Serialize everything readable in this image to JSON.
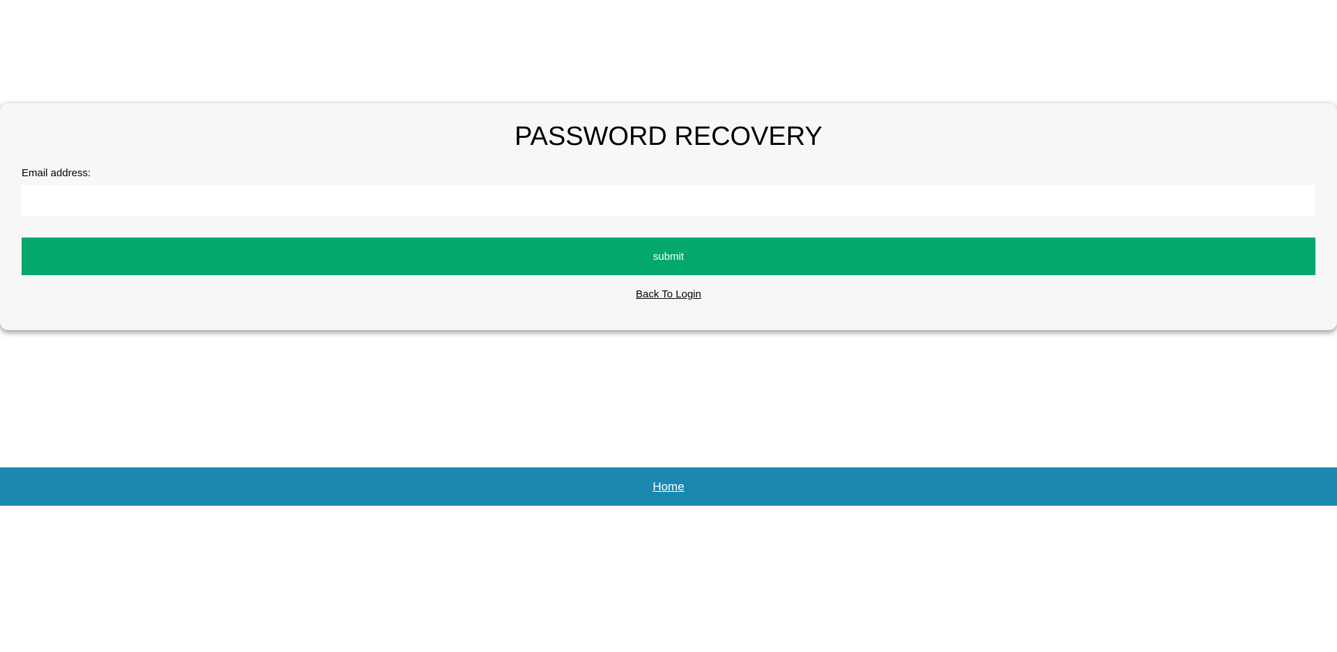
{
  "recovery": {
    "title": "PASSWORD RECOVERY",
    "email_label": "Email address:",
    "email_value": "",
    "email_placeholder": "",
    "submit_label": "submit",
    "back_link_label": "Back To Login"
  },
  "footer": {
    "home_link_label": "Home"
  },
  "colors": {
    "submit_bg": "#03a96c",
    "footer_bg": "#1b88b0",
    "card_bg": "#f7f7f7"
  }
}
